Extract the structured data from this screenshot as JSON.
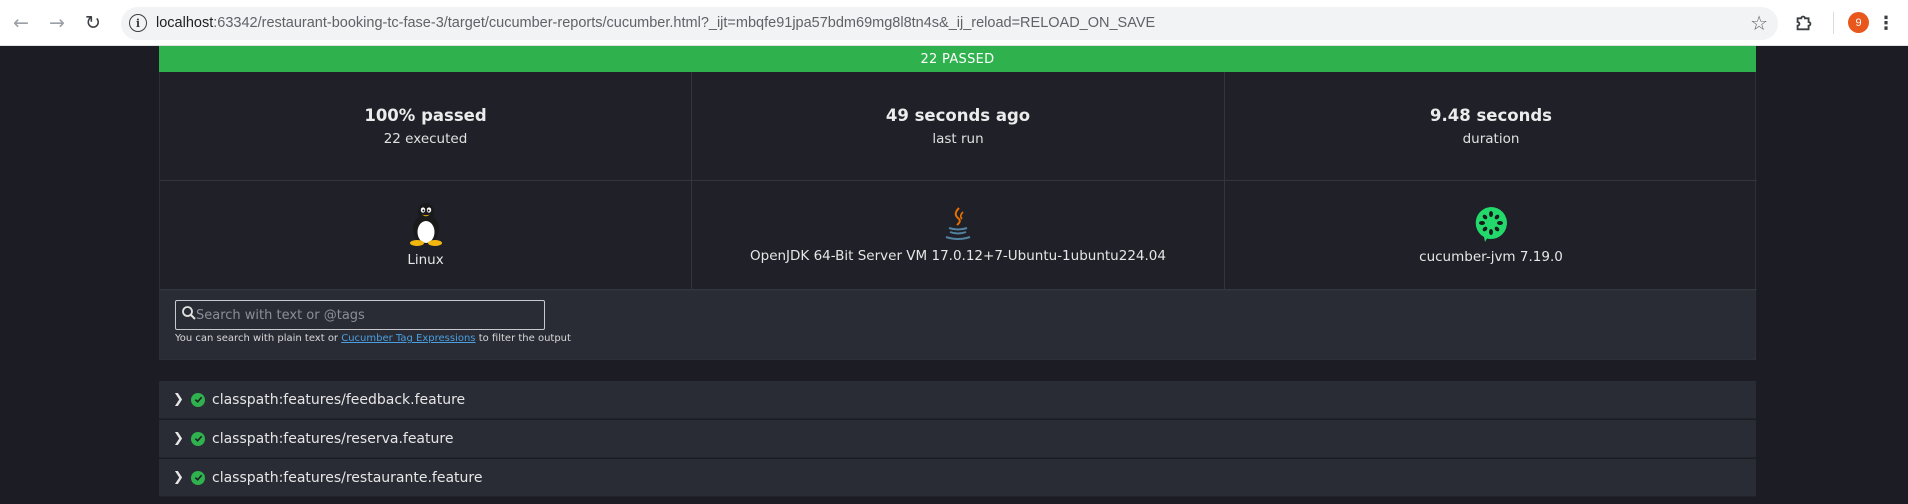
{
  "browser": {
    "url_host": "localhost",
    "url_rest": ":63342/restaurant-booking-tc-fase-3/target/cucumber-reports/cucumber.html?_ijt=mbqfe91jpa57bdm69mg8l8tn4s&_ij_reload=RELOAD_ON_SAVE",
    "profile_initial": "9",
    "icons": [
      "back-arrow-icon",
      "forward-arrow-icon",
      "reload-icon",
      "site-info-icon",
      "bookmark-star-icon",
      "extensions-puzzle-icon",
      "more-menu-icon"
    ]
  },
  "report": {
    "banner": "22 PASSED",
    "banner_color": "#2fb24d",
    "stats": [
      {
        "big": "100% passed",
        "small": "22 executed"
      },
      {
        "big": "49 seconds ago",
        "small": "last run"
      },
      {
        "big": "9.48 seconds",
        "small": "duration"
      }
    ],
    "env": {
      "os": "Linux",
      "runtime": "OpenJDK 64-Bit Server VM 17.0.12+7-Ubuntu-1ubuntu224.04",
      "implementation": "cucumber-jvm 7.19.0",
      "icons": [
        "linux-tux-icon",
        "java-logo-icon",
        "cucumber-logo-icon"
      ]
    },
    "search": {
      "placeholder": "Search with text or @tags",
      "hint_prefix": "You can search with plain text or ",
      "hint_link": "Cucumber Tag Expressions",
      "hint_suffix": " to filter the output"
    },
    "features": [
      {
        "name": "classpath:features/feedback.feature",
        "status": "passed"
      },
      {
        "name": "classpath:features/reserva.feature",
        "status": "passed"
      },
      {
        "name": "classpath:features/restaurante.feature",
        "status": "passed"
      }
    ]
  }
}
